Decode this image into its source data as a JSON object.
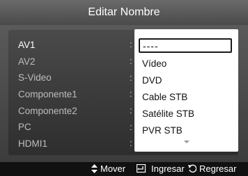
{
  "header": {
    "title": "Editar Nombre"
  },
  "inputs": [
    {
      "label": "AV1",
      "active": true
    },
    {
      "label": "AV2"
    },
    {
      "label": "S-Video"
    },
    {
      "label": "Componente1"
    },
    {
      "label": "Componente2"
    },
    {
      "label": "PC"
    },
    {
      "label": "HDMI1"
    }
  ],
  "separator": ":",
  "dropdown": {
    "selected_value": "----",
    "options": [
      "Vídeo",
      "DVD",
      "Cable STB",
      "Satélite STB",
      "PVR STB"
    ]
  },
  "footer": {
    "move_label": "Mover",
    "enter_label": "Ingresar",
    "return_label": "Regresar",
    "move_icon": "up-down-arrows-icon",
    "enter_icon": "enter-icon",
    "return_icon": "return-icon"
  }
}
